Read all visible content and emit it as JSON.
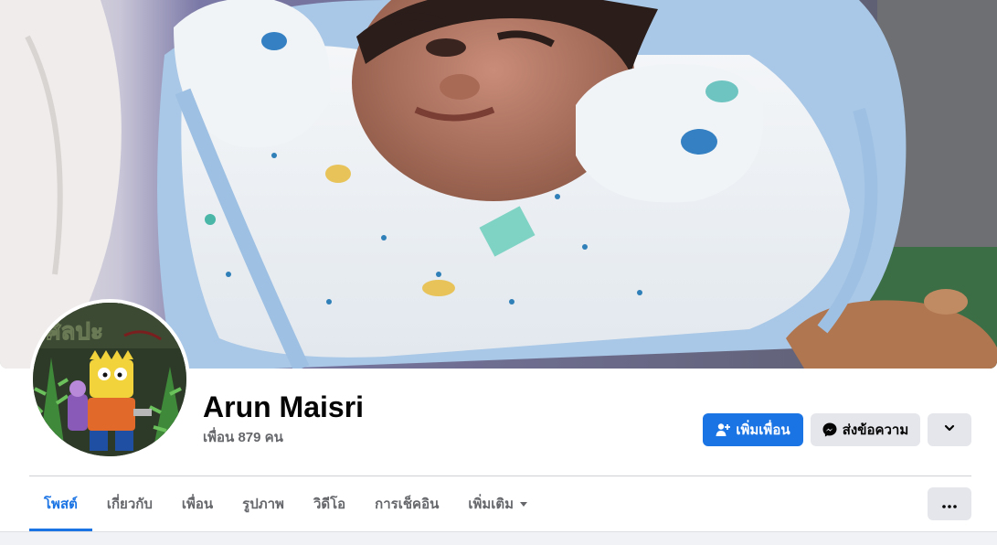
{
  "profile": {
    "name": "Arun Maisri",
    "friends_count": "เพื่อน 879 คน"
  },
  "cover_photo": {
    "icon": "cover-photo-baby"
  },
  "avatar": {
    "icon": "profile-picture-cartoon",
    "lettering": "ศิลปะ"
  },
  "actions": {
    "add_friend_label": "เพิ่มเพื่อน",
    "message_label": "ส่งข้อความ"
  },
  "tabs": [
    {
      "label": "โพสต์",
      "active": true
    },
    {
      "label": "เกี่ยวกับ",
      "active": false
    },
    {
      "label": "เพื่อน",
      "active": false
    },
    {
      "label": "รูปภาพ",
      "active": false
    },
    {
      "label": "วิดีโอ",
      "active": false
    },
    {
      "label": "การเช็คอิน",
      "active": false
    },
    {
      "label": "เพิ่มเติม",
      "active": false
    }
  ],
  "colors": {
    "accent": "#1b74e4",
    "secondary_button": "#e4e6eb",
    "muted_text": "#65676b",
    "page_background": "#f0f2f5"
  }
}
